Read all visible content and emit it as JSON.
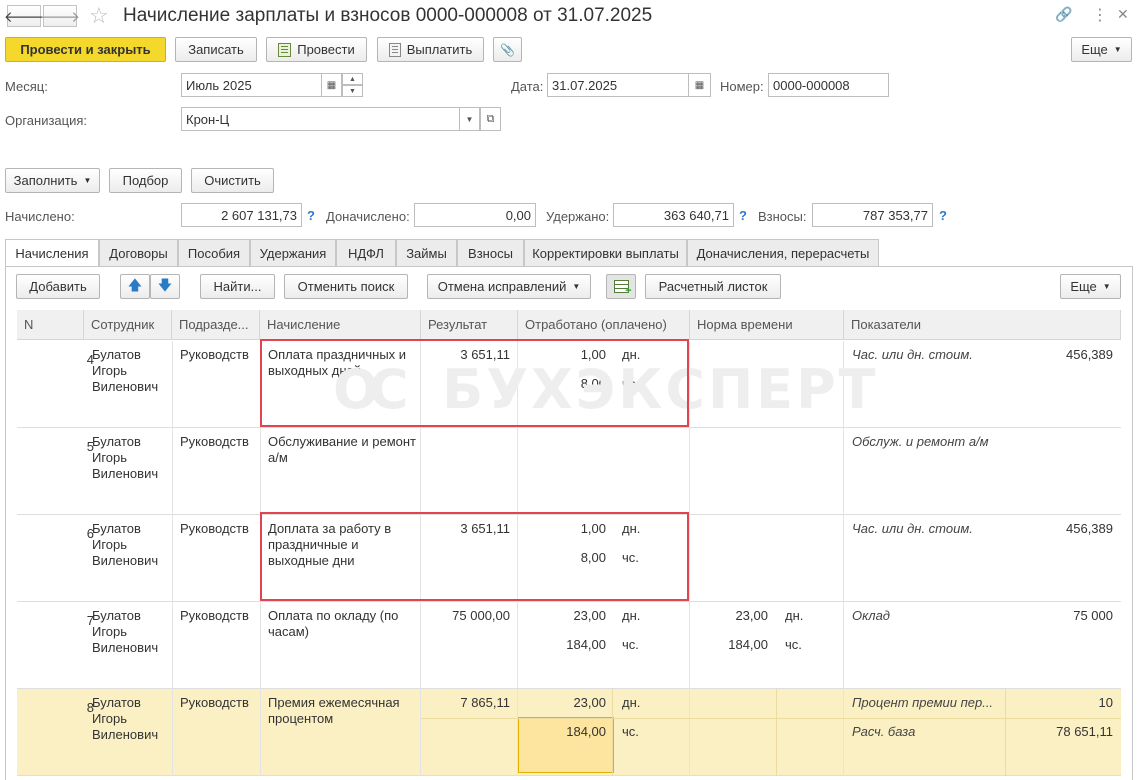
{
  "window": {
    "title": "Начисление зарплаты и взносов 0000-000008 от 31.07.2025",
    "back_glyph": "🡐",
    "forward_glyph": "🡒",
    "star_glyph": "☆",
    "link_glyph": "🔗",
    "more_glyph": "⋮",
    "close_glyph": "✕"
  },
  "toolbar": {
    "post_close": "Провести и закрыть",
    "save": "Записать",
    "post": "Провести",
    "pay": "Выплатить",
    "attach_glyph": "📎",
    "more": "Еще"
  },
  "form": {
    "month_label": "Месяц:",
    "month_value": "Июль 2025",
    "date_label": "Дата:",
    "date_value": "31.07.2025",
    "number_label": "Номер:",
    "number_value": "0000-000008",
    "org_label": "Организация:",
    "org_value": "Крон-Ц"
  },
  "actions": {
    "fill": "Заполнить",
    "pick": "Подбор",
    "clear": "Очистить"
  },
  "totals": {
    "accrued_label": "Начислено:",
    "accrued_value": "2 607 131,73",
    "extra_label": "Доначислено:",
    "extra_value": "0,00",
    "withheld_label": "Удержано:",
    "withheld_value": "363 640,71",
    "contrib_label": "Взносы:",
    "contrib_value": "787 353,77",
    "help": "?"
  },
  "tabs": [
    "Начисления",
    "Договоры",
    "Пособия",
    "Удержания",
    "НДФЛ",
    "Займы",
    "Взносы",
    "Корректировки выплаты",
    "Доначисления, перерасчеты"
  ],
  "table_toolbar": {
    "add": "Добавить",
    "up_glyph": "🡅",
    "down_glyph": "🡇",
    "find": "Найти...",
    "cancel_search": "Отменить поиск",
    "cancel_fix": "Отмена исправлений",
    "payslip": "Расчетный листок",
    "more": "Еще"
  },
  "columns": [
    "N",
    "Сотрудник",
    "Подразде...",
    "Начисление",
    "Результат",
    "Отработано (оплачено)",
    "Норма времени",
    "Показатели"
  ],
  "watermark": "БУХЭКСПЕРТ",
  "rows": [
    {
      "n": "4",
      "employee": "Булатов Игорь Виленович",
      "dept": "Руководств",
      "accrual": "Оплата праздничных и выходных дней",
      "result": "3 651,11",
      "worked1": "1,00",
      "unit1": "дн.",
      "worked2": "8,00",
      "unit2": "чс.",
      "norm1": "",
      "normunit1": "",
      "norm2": "",
      "normunit2": "",
      "ind1": "Час. или дн. стоим.",
      "indval1": "456,389",
      "ind2": "",
      "indval2": ""
    },
    {
      "n": "5",
      "employee": "Булатов Игорь Виленович",
      "dept": "Руководств",
      "accrual": "Обслуживание и ремонт а/м",
      "result": "",
      "worked1": "",
      "unit1": "",
      "worked2": "",
      "unit2": "",
      "norm1": "",
      "normunit1": "",
      "norm2": "",
      "normunit2": "",
      "ind1": "Обслуж. и ремонт а/м",
      "indval1": "",
      "ind2": "",
      "indval2": ""
    },
    {
      "n": "6",
      "employee": "Булатов Игорь Виленович",
      "dept": "Руководств",
      "accrual": "Доплата за работу в праздничные и выходные дни",
      "result": "3 651,11",
      "worked1": "1,00",
      "unit1": "дн.",
      "worked2": "8,00",
      "unit2": "чс.",
      "norm1": "",
      "normunit1": "",
      "norm2": "",
      "normunit2": "",
      "ind1": "Час. или дн. стоим.",
      "indval1": "456,389",
      "ind2": "",
      "indval2": ""
    },
    {
      "n": "7",
      "employee": "Булатов Игорь Виленович",
      "dept": "Руководств",
      "accrual": "Оплата по окладу (по часам)",
      "result": "75 000,00",
      "worked1": "23,00",
      "unit1": "дн.",
      "worked2": "184,00",
      "unit2": "чс.",
      "norm1": "23,00",
      "normunit1": "дн.",
      "norm2": "184,00",
      "normunit2": "чс.",
      "ind1": "Оклад",
      "indval1": "75 000",
      "ind2": "",
      "indval2": ""
    },
    {
      "n": "8",
      "employee": "Булатов Игорь Виленович",
      "dept": "Руководств",
      "accrual": "Премия ежемесячная процентом",
      "result": "7 865,11",
      "worked1": "23,00",
      "unit1": "дн.",
      "worked2": "184,00",
      "unit2": "чс.",
      "norm1": "",
      "normunit1": "",
      "norm2": "",
      "normunit2": "",
      "ind1": "Процент премии пер...",
      "indval1": "10",
      "ind2": "Расч. база",
      "indval2": "78 651,11"
    }
  ]
}
